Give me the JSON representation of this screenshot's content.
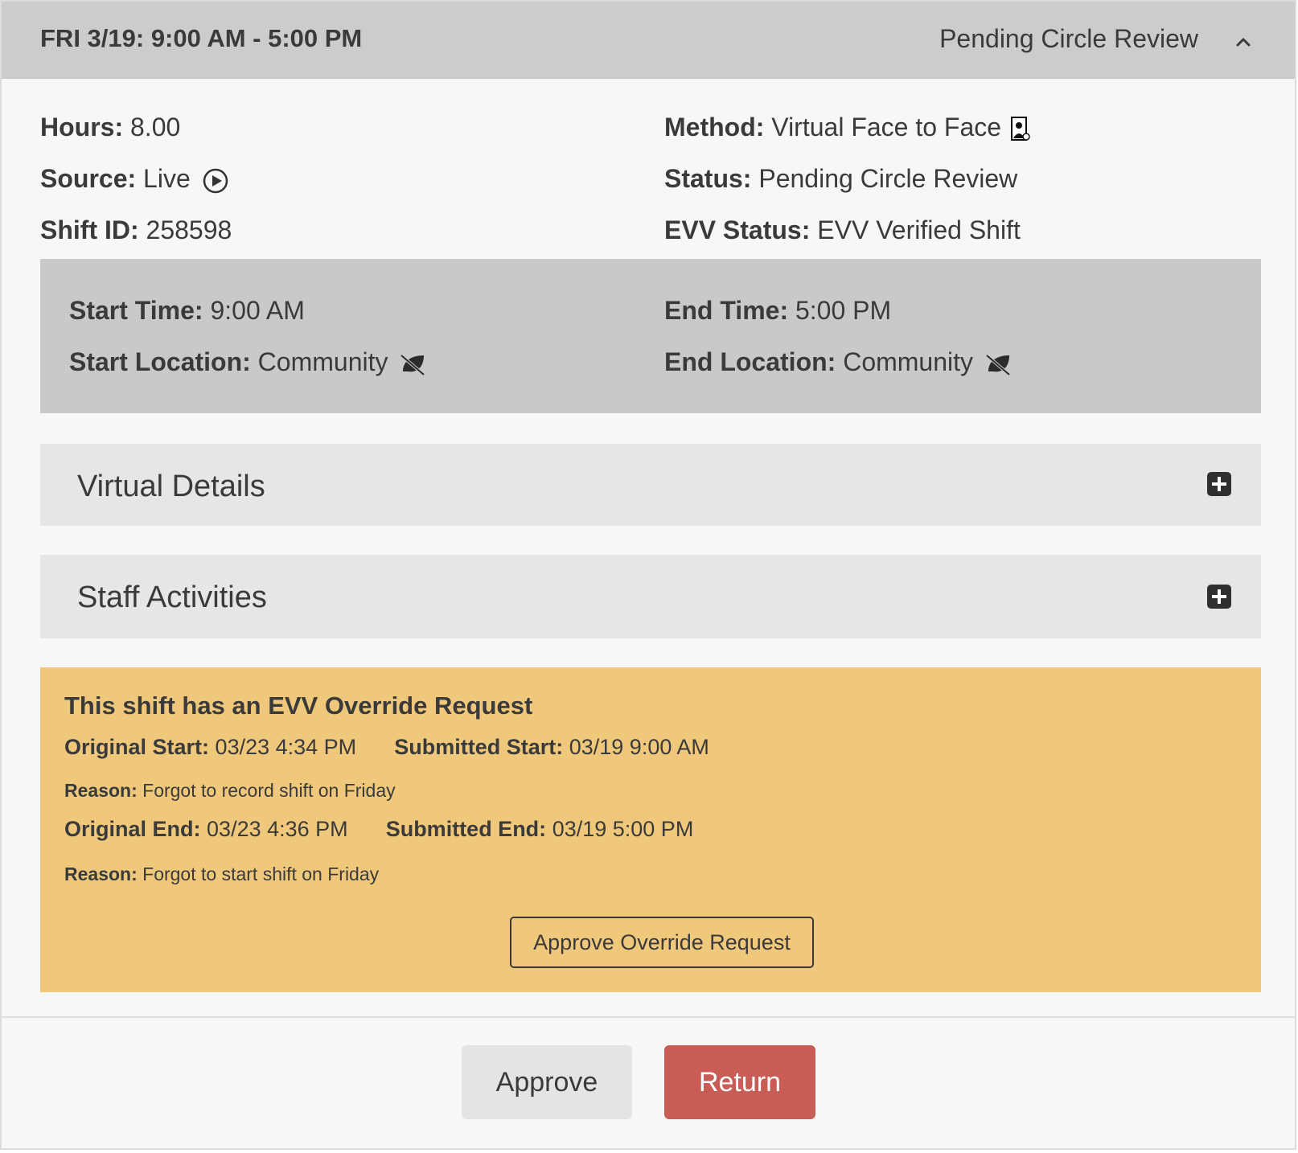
{
  "header": {
    "shift_title": "FRI 3/19: 9:00 AM - 5:00 PM",
    "status": "Pending Circle Review"
  },
  "details": {
    "hours_label": "Hours:",
    "hours_value": "8.00",
    "source_label": "Source:",
    "source_value": "Live",
    "shift_id_label": "Shift ID:",
    "shift_id_value": "258598",
    "method_label": "Method:",
    "method_value": "Virtual Face to Face",
    "status_label": "Status:",
    "status_value": "Pending Circle Review",
    "evv_status_label": "EVV Status:",
    "evv_status_value": "EVV Verified Shift"
  },
  "times": {
    "start_time_label": "Start Time:",
    "start_time_value": "9:00 AM",
    "end_time_label": "End Time:",
    "end_time_value": "5:00 PM",
    "start_location_label": "Start Location:",
    "start_location_value": "Community",
    "end_location_label": "End Location:",
    "end_location_value": "Community"
  },
  "sections": {
    "virtual_details": "Virtual Details",
    "staff_activities": "Staff Activities"
  },
  "override": {
    "title": "This shift has an EVV Override Request",
    "original_start_label": "Original Start:",
    "original_start_value": "03/23 4:34 PM",
    "submitted_start_label": "Submitted Start:",
    "submitted_start_value": "03/19 9:00 AM",
    "start_reason_label": "Reason:",
    "start_reason_value": "Forgot to record shift on Friday",
    "original_end_label": "Original End:",
    "original_end_value": "03/23 4:36 PM",
    "submitted_end_label": "Submitted End:",
    "submitted_end_value": "03/19 5:00 PM",
    "end_reason_label": "Reason:",
    "end_reason_value": "Forgot to start shift on Friday",
    "approve_override_label": "Approve Override Request"
  },
  "footer": {
    "approve_label": "Approve",
    "return_label": "Return"
  },
  "colors": {
    "header_bg": "#cccccc",
    "panel_bg": "#c9c9c9",
    "accordion_bg": "#e6e6e6",
    "override_bg": "#f0c87b",
    "return_button": "#c95c55",
    "approve_button": "#e4e4e4"
  },
  "icons": {
    "collapse": "chevron-up-icon",
    "source": "play-circle-icon",
    "method": "person-video-icon",
    "location": "leaf-slash-icon",
    "expand": "plus-square-icon"
  }
}
